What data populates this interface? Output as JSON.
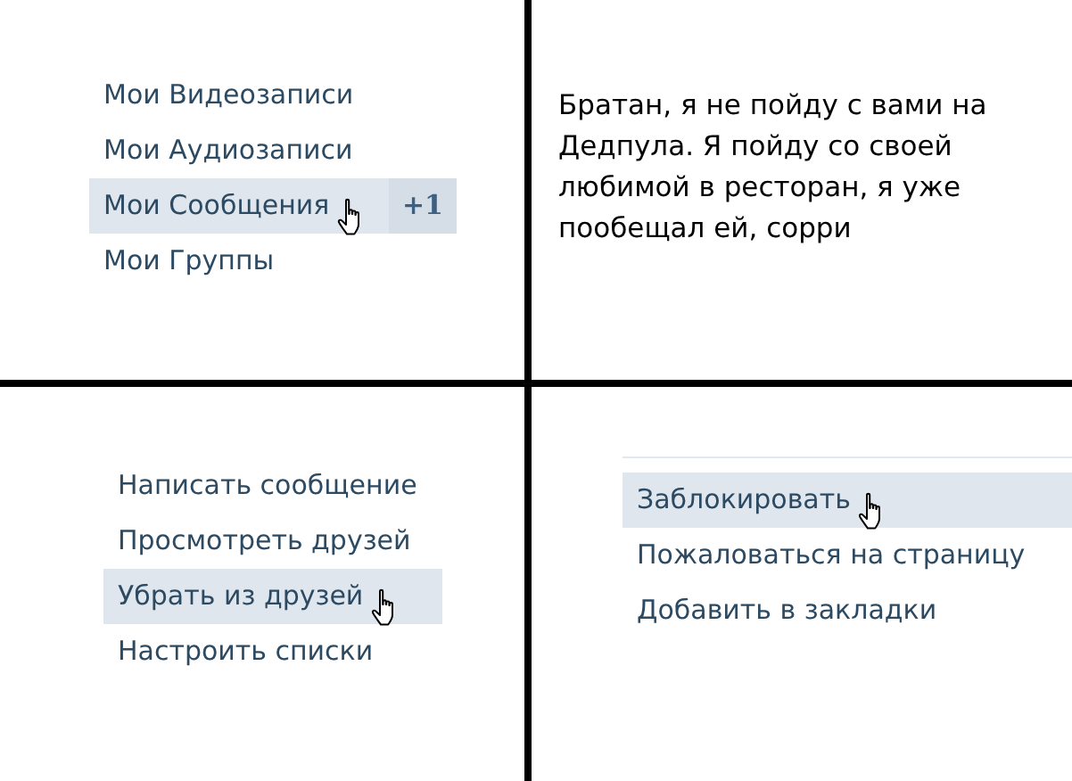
{
  "panel_1": {
    "menu": [
      {
        "label": "Мои Видеозаписи",
        "selected": false
      },
      {
        "label": "Мои Аудиозаписи",
        "selected": false
      },
      {
        "label": "Мои Сообщения",
        "selected": true,
        "badge": "+1"
      },
      {
        "label": "Мои Группы",
        "selected": false
      }
    ]
  },
  "panel_2": {
    "text": "Братан, я не пойду с вами на Дедпула. Я пойду со своей любимой в ресторан, я уже пообещал ей, сорри"
  },
  "panel_3": {
    "menu": [
      {
        "label": "Написать сообщение",
        "selected": false
      },
      {
        "label": "Просмотреть друзей",
        "selected": false
      },
      {
        "label": "Убрать из друзей",
        "selected": true
      },
      {
        "label": "Настроить списки",
        "selected": false
      }
    ]
  },
  "panel_4": {
    "menu": [
      {
        "label": "Заблокировать",
        "selected": true
      },
      {
        "label": "Пожаловаться на страницу",
        "selected": false
      },
      {
        "label": "Добавить в закладки",
        "selected": false
      }
    ]
  }
}
